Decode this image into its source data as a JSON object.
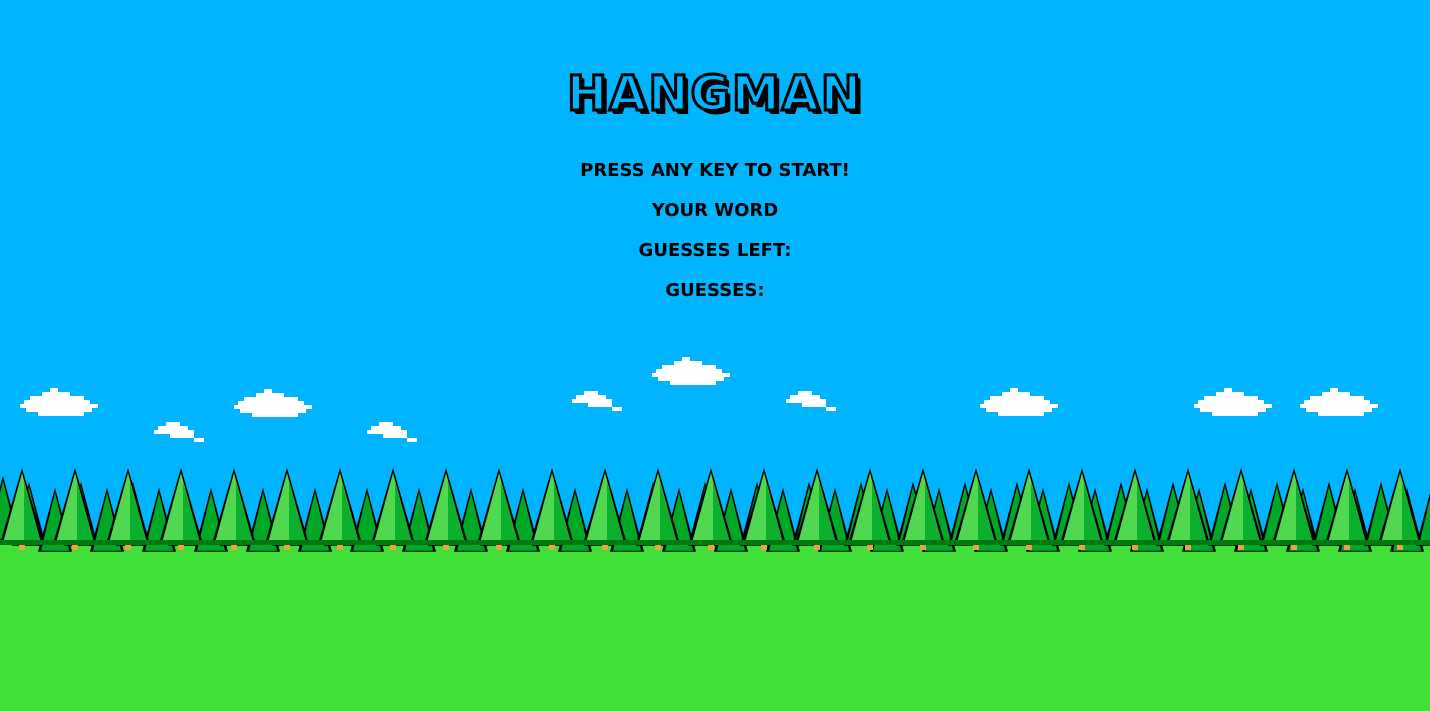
{
  "game": {
    "title": "Hangman",
    "prompt": "Press any key to start!",
    "word_label": "Your Word",
    "guesses_left_label": "Guesses Left:",
    "guesses_label": "Guesses:"
  },
  "colors": {
    "sky": "#00b4ff",
    "grass": "#40e038",
    "tree_dark": "#007a10",
    "tree_mid": "#00a828",
    "tree_light": "#50d850",
    "trunk": "#f0a040",
    "cloud": "#ffffff",
    "text": "#000000"
  }
}
